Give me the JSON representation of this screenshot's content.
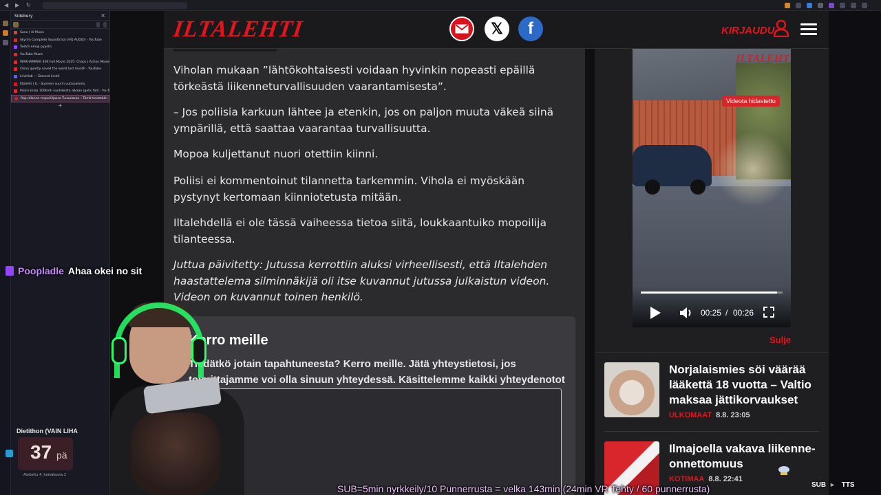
{
  "sidebery": {
    "title": "Sidebery",
    "close": "×",
    "tabs": [
      {
        "label": "Suno | AI Music",
        "color": "#c24b4b"
      },
      {
        "label": "Skyrim Complete Soundtrack (HQ AUDIO) - YouTube",
        "color": "#e02b2b"
      },
      {
        "label": "Twitch emoji pyynto",
        "color": "#9146ff"
      },
      {
        "label": "YouTube Music",
        "color": "#e02b2b"
      },
      {
        "label": "WARHAMMER 40K Full Movie 2025: Chaos | Action Movies",
        "color": "#e02b2b"
      },
      {
        "label": "China quietly saved the world last month - YouTube",
        "color": "#e02b2b"
      },
      {
        "label": "LinkHub — Discord Linkit",
        "color": "#5865f2"
      },
      {
        "label": "Iltalehti | IL - Suomen suurin uutispalvelu",
        "color": "#e2141c"
      },
      {
        "label": "Poliisi kiilaa 100kmh vauhdeista alkaan (gelic fall) - YouTube",
        "color": "#e02b2b"
      },
      {
        "label": "Raju tilanne mopoiilijassa Tuusulassa – Tämä tiedetään nyt",
        "color": "#e2141c"
      }
    ],
    "add": "+"
  },
  "chat": {
    "user": "Poopladle",
    "message": "Ahaa okei no sit"
  },
  "header": {
    "logo": "ILTALEHTI",
    "login": "KIRJAUDU",
    "x_label": "𝕏",
    "fb_label": "f"
  },
  "article": {
    "paragraphs": [
      "Viholan mukaan ”lähtökohtaisesti voidaan hyvinkin nopeasti epäillä törkeästä liikenneturvallisuuden vaarantamisesta”.",
      "– Jos poliisia karkuun lähtee ja etenkin, jos on paljon muuta väkeä siinä ympärillä, että saattaa vaarantaa turvallisuutta.",
      "Mopoa kuljettanut nuori otettiin kiinni.",
      "Poliisi ei kommentoinut tilannetta tarkemmin. Vihola ei myöskään pystynyt kertomaan kiinniotetusta mitään.",
      "Iltalehdellä ei ole tässä vaiheessa tietoa siitä, loukkaantuiko mopoilija tilanteessa."
    ],
    "update": "Juttua päivitetty: Jutussa kerrottiin aluksi virheellisesti, että Iltalehden haastattelema silminnäkijä oli itse kuvannut jutussa julkaistun videon. Videon on kuvannut toinen henkilö."
  },
  "feedback": {
    "title": "Kerro meille",
    "text": "Tiedätkö jotain tapahtuneesta? Kerro meille. Jätä yhteystietosi, jos toimittajamme voi olla sinuun yhteydessä. Käsittelemme kaikki yhteydenotot luottamuksellisesti.*"
  },
  "video": {
    "watermark": "ILTALEHTI",
    "badge": "Videota hidastettu",
    "current_time": "00:25",
    "separator": "/",
    "duration": "00:26",
    "progress": 0.96,
    "close": "Sulje"
  },
  "news": [
    {
      "title": "Norjalaismies söi väärää lääkettä 18 vuotta – Valtio maksaa jättikorvaukset",
      "category": "ULKOMAAT",
      "date": "8.8. 23:05"
    },
    {
      "title": "Ilmajoella vakava liikenne-onnettomuus",
      "category": "KOTIMAA",
      "date": "8.8. 22:41"
    }
  ],
  "widget": {
    "label": "Dietithon (VAIN LIHA",
    "number": "37",
    "unit": "pä",
    "foot": "Aloitettu 4. heinäkuuta 2"
  },
  "overlay": {
    "sub_text": "SUB=5min nyrkkeily/10 Punnerrusta = velka 143min (24min VR Tehty / 60 punnerrusta)",
    "sub_tag": "SUB",
    "arrow": "▸",
    "tts_tag": "TTS"
  }
}
